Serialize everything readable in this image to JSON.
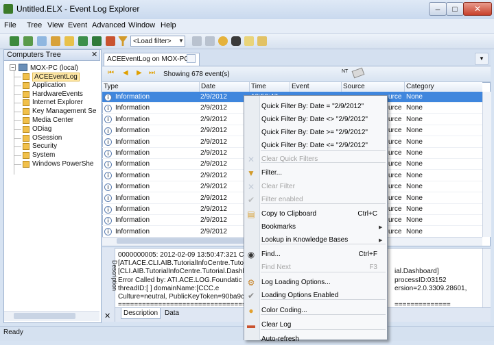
{
  "window": {
    "title": "Untitled.ELX - Event Log Explorer",
    "minimize": "–",
    "maximize": "□",
    "close": "✕"
  },
  "menubar": [
    "File",
    "Tree",
    "View",
    "Event",
    "Advanced",
    "Window",
    "Help"
  ],
  "toolbar": {
    "load_filter": "<Load filter>",
    "icons": [
      "open-icon",
      "save-icon",
      "refresh-icon",
      "folder-icon",
      "print-icon",
      "save-disk-icon",
      "clear-log-icon",
      "filter-icon",
      "remove-filter-icon",
      "filter-enabled-icon",
      "bookmark-icon",
      "find-icon",
      "export-icon",
      "print-preview-icon"
    ]
  },
  "tree": {
    "title": "Computers Tree",
    "close": "✕",
    "root": "MOX-PC (local)",
    "items": [
      "ACEEventLog",
      "Application",
      "HardwareEvents",
      "Internet Explorer",
      "Key Management Se",
      "Media Center",
      "ODiag",
      "OSession",
      "Security",
      "System",
      "Windows PowerShe"
    ]
  },
  "document_tab": {
    "label": "ACEEventLog on MOX-PC",
    "close": "✕"
  },
  "navbar": {
    "count_label": "Showing 678 event(s)",
    "nt_label": "NT"
  },
  "grid": {
    "columns": [
      "Type",
      "Date",
      "Time",
      "Event",
      "Source",
      "Category"
    ],
    "rows": [
      {
        "type": "Information",
        "date": "2/9/2012",
        "time": "13:50:47",
        "source": "urce",
        "category": "None",
        "selected": true
      },
      {
        "type": "Information",
        "date": "2/9/2012",
        "time": "",
        "source": "urce",
        "category": "None"
      },
      {
        "type": "Information",
        "date": "2/9/2012",
        "time": "",
        "source": "urce",
        "category": "None"
      },
      {
        "type": "Information",
        "date": "2/9/2012",
        "time": "",
        "source": "urce",
        "category": "None"
      },
      {
        "type": "Information",
        "date": "2/9/2012",
        "time": "",
        "source": "urce",
        "category": "None"
      },
      {
        "type": "Information",
        "date": "2/9/2012",
        "time": "",
        "source": "urce",
        "category": "None"
      },
      {
        "type": "Information",
        "date": "2/9/2012",
        "time": "",
        "source": "urce",
        "category": "None"
      },
      {
        "type": "Information",
        "date": "2/9/2012",
        "time": "",
        "source": "urce",
        "category": "None"
      },
      {
        "type": "Information",
        "date": "2/9/2012",
        "time": "",
        "source": "urce",
        "category": "None"
      },
      {
        "type": "Information",
        "date": "2/9/2012",
        "time": "",
        "source": "urce",
        "category": "None"
      },
      {
        "type": "Information",
        "date": "2/9/2012",
        "time": "",
        "source": "urce",
        "category": "None"
      },
      {
        "type": "Information",
        "date": "2/9/2012",
        "time": "",
        "source": "urce",
        "category": "None"
      },
      {
        "type": "Information",
        "date": "2/9/2012",
        "time": "",
        "source": "urce",
        "category": "None"
      }
    ]
  },
  "description": {
    "side_label": "Description",
    "pin": "✕",
    "lines": [
      {
        "left": "0000000005: 2012-02-09 13:50:47:321   C",
        "right": ""
      },
      {
        "left": "[ATI.ACE.CLI.AIB.TutorialInfoCentre.Tutori",
        "right": ""
      },
      {
        "left": "[CLI.AIB.TutorialInfoCentre.Tutorial.Dashb",
        "right": "ial.Dashboard]"
      },
      {
        "left": " Error     Called by: ATI.ACE.LOG.Foundatic",
        "right": "processID:03152"
      },
      {
        "left": "threadID:[              ] domainName:[CCC.e",
        "right": "ersion=2.0.3309.28601,"
      },
      {
        "left": "Culture=neutral, PublicKeyToken=90ba9c70",
        "right": ""
      },
      {
        "left": "================================",
        "right": "=============="
      }
    ],
    "tabs": [
      "Description",
      "Data"
    ]
  },
  "status": "Ready",
  "context_menu": {
    "items": [
      {
        "label": "Quick Filter By: Date  = \"2/9/2012\"",
        "enabled": true
      },
      {
        "label": "Quick Filter By: Date <> \"2/9/2012\"",
        "enabled": true
      },
      {
        "label": "Quick Filter By: Date >= \"2/9/2012\"",
        "enabled": true
      },
      {
        "label": "Quick Filter By: Date <= \"2/9/2012\"",
        "enabled": true
      },
      {
        "label": "Clear Quick Filters",
        "enabled": false,
        "icon": "clear-filter-icon"
      },
      {
        "label": "Filter...",
        "enabled": true,
        "icon": "filter-icon"
      },
      {
        "label": "Clear Filter",
        "enabled": false,
        "icon": "clear-filter-icon"
      },
      {
        "label": "Filter enabled",
        "enabled": false,
        "icon": "check-icon"
      },
      {
        "label": "Copy to Clipboard",
        "shortcut": "Ctrl+C",
        "enabled": true,
        "icon": "clipboard-icon"
      },
      {
        "label": "Bookmarks",
        "enabled": true,
        "submenu": true
      },
      {
        "label": "Lookup in Knowledge Bases",
        "enabled": true,
        "submenu": true
      },
      {
        "label": "Find...",
        "shortcut": "Ctrl+F",
        "enabled": true,
        "icon": "binoculars-icon"
      },
      {
        "label": "Find Next",
        "shortcut": "F3",
        "enabled": false
      },
      {
        "label": "Log Loading Options...",
        "enabled": true,
        "icon": "options-icon"
      },
      {
        "label": "Loading Options Enabled",
        "enabled": true,
        "icon": "check-icon"
      },
      {
        "label": "Color Coding...",
        "enabled": true,
        "icon": "palette-icon"
      },
      {
        "label": "Clear Log",
        "enabled": true,
        "icon": "clear-log-icon"
      },
      {
        "label": "Auto-refresh",
        "enabled": true
      }
    ]
  }
}
